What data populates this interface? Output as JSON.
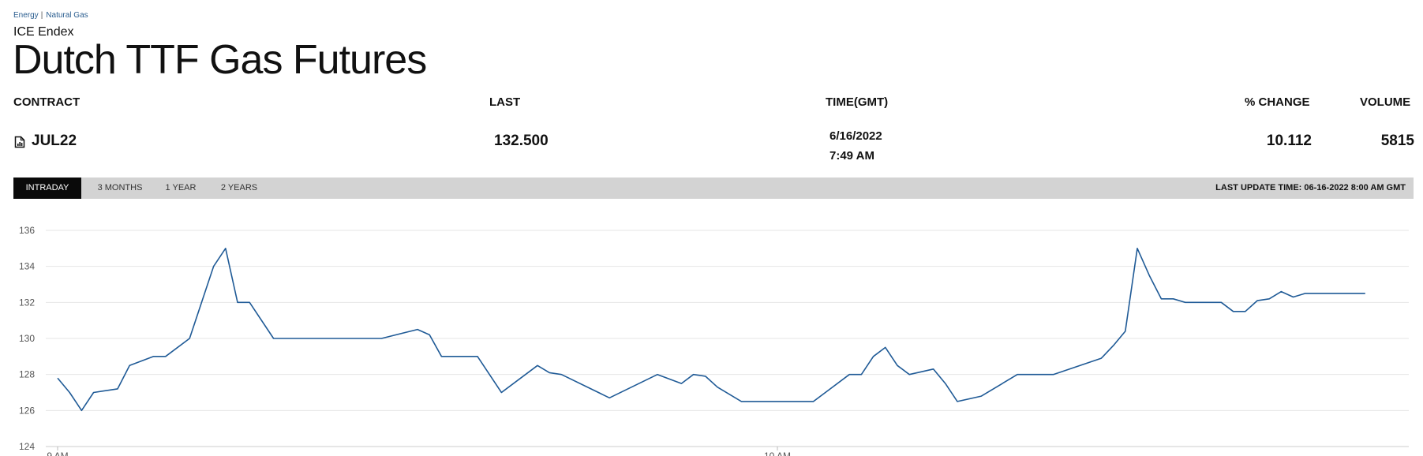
{
  "breadcrumb": {
    "item1": "Energy",
    "separator": "|",
    "item2": "Natural Gas"
  },
  "exchange": "ICE Endex",
  "title": "Dutch TTF Gas Futures",
  "table": {
    "headers": {
      "contract": "CONTRACT",
      "last": "LAST",
      "time": "TIME(GMT)",
      "change": "% CHANGE",
      "volume": "VOLUME"
    },
    "row": {
      "contract": "JUL22",
      "last": "132.500",
      "date": "6/16/2022",
      "time": "7:49 AM",
      "change": "10.112",
      "volume": "5815"
    }
  },
  "tabs": [
    {
      "label": "INTRADAY",
      "active": true
    },
    {
      "label": "3 MONTHS",
      "active": false
    },
    {
      "label": "1 YEAR",
      "active": false
    },
    {
      "label": "2 YEARS",
      "active": false
    }
  ],
  "last_update": "LAST UPDATE TIME: 06-16-2022 8:00 AM GMT",
  "icons": {
    "contract": "document-chart-icon"
  },
  "colors": {
    "line": "#1f5a96",
    "tab_active_bg": "#0a0a0a",
    "tabbar_bg": "#d3d3d3"
  },
  "chart_data": {
    "type": "line",
    "x_unit": "time (HH:MM, GMT)",
    "ylim": [
      124,
      136
    ],
    "yticks": [
      124,
      126,
      128,
      130,
      132,
      134,
      136
    ],
    "xticks": [
      {
        "x": "09:00",
        "label": "9 AM"
      },
      {
        "x": "10:00",
        "label": "10 AM"
      }
    ],
    "grid": true,
    "series": [
      {
        "x": [
          "09:00",
          "09:01",
          "09:02",
          "09:03",
          "09:05",
          "09:06",
          "09:08",
          "09:09",
          "09:11",
          "09:13",
          "09:14",
          "09:15",
          "09:16",
          "09:18",
          "09:27",
          "09:30",
          "09:31",
          "09:32",
          "09:35",
          "09:37",
          "09:40",
          "09:41",
          "09:42",
          "09:46",
          "09:50",
          "09:52",
          "09:53",
          "09:54",
          "09:55",
          "09:57",
          "09:59",
          "10:03",
          "10:04",
          "10:06",
          "10:07",
          "10:08",
          "10:09",
          "10:10",
          "10:11",
          "10:13",
          "10:14",
          "10:15",
          "10:17",
          "10:20",
          "10:21",
          "10:22",
          "10:23",
          "10:27",
          "10:28",
          "10:29",
          "10:30",
          "10:31",
          "10:32",
          "10:33",
          "10:34",
          "10:35",
          "10:36",
          "10:37",
          "10:38",
          "10:39",
          "10:40",
          "10:41",
          "10:42",
          "10:43",
          "10:44",
          "10:45",
          "10:46",
          "10:47",
          "10:48",
          "10:49"
        ],
        "y": [
          127.8,
          127.0,
          126.0,
          127.0,
          127.2,
          128.5,
          129.0,
          129.0,
          130.0,
          134.0,
          135.0,
          132.0,
          132.0,
          130.0,
          130.0,
          130.5,
          130.2,
          129.0,
          129.0,
          127.0,
          128.5,
          128.1,
          128.0,
          126.7,
          128.0,
          127.5,
          128.0,
          127.9,
          127.3,
          126.5,
          126.5,
          126.5,
          127.0,
          128.0,
          128.0,
          129.0,
          129.5,
          128.5,
          128.0,
          128.3,
          127.5,
          126.5,
          126.8,
          128.0,
          128.0,
          128.0,
          128.0,
          128.9,
          129.6,
          130.4,
          135.0,
          133.5,
          132.2,
          132.2,
          132.0,
          132.0,
          132.0,
          132.0,
          131.5,
          131.5,
          132.1,
          132.2,
          132.6,
          132.3,
          132.5,
          132.5,
          132.5,
          132.5,
          132.5,
          132.5
        ]
      }
    ]
  }
}
